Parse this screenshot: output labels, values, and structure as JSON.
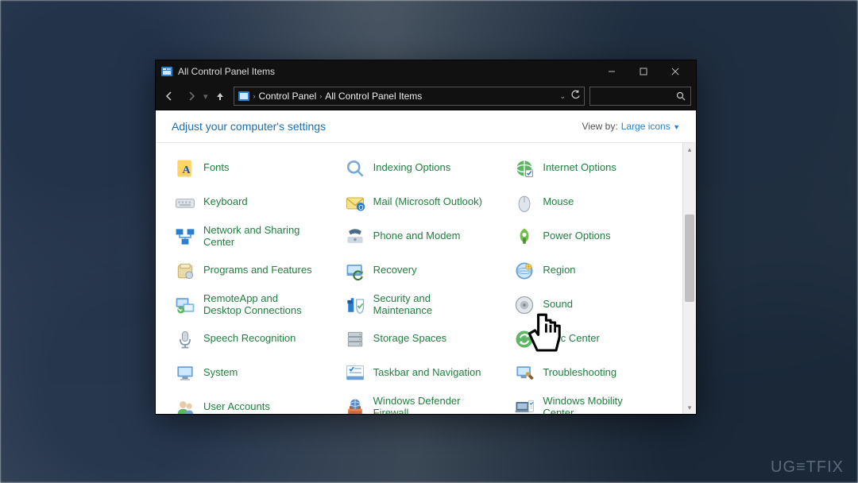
{
  "window_title": "All Control Panel Items",
  "breadcrumb": [
    "Control Panel",
    "All Control Panel Items"
  ],
  "subheader": {
    "title": "Adjust your computer's settings",
    "view_by_label": "View by:",
    "view_by_value": "Large icons"
  },
  "items": [
    {
      "label": "Fonts",
      "icon": "fonts-icon"
    },
    {
      "label": "Indexing Options",
      "icon": "indexing-icon"
    },
    {
      "label": "Internet Options",
      "icon": "internet-options-icon"
    },
    {
      "label": "Keyboard",
      "icon": "keyboard-icon"
    },
    {
      "label": "Mail (Microsoft Outlook)",
      "icon": "mail-icon"
    },
    {
      "label": "Mouse",
      "icon": "mouse-icon"
    },
    {
      "label": "Network and Sharing Center",
      "icon": "network-icon"
    },
    {
      "label": "Phone and Modem",
      "icon": "phone-modem-icon"
    },
    {
      "label": "Power Options",
      "icon": "power-icon"
    },
    {
      "label": "Programs and Features",
      "icon": "programs-icon"
    },
    {
      "label": "Recovery",
      "icon": "recovery-icon"
    },
    {
      "label": "Region",
      "icon": "region-icon"
    },
    {
      "label": "RemoteApp and Desktop Connections",
      "icon": "remoteapp-icon"
    },
    {
      "label": "Security and Maintenance",
      "icon": "security-icon"
    },
    {
      "label": "Sound",
      "icon": "sound-icon"
    },
    {
      "label": "Speech Recognition",
      "icon": "speech-icon"
    },
    {
      "label": "Storage Spaces",
      "icon": "storage-icon"
    },
    {
      "label": "Sync Center",
      "icon": "sync-icon"
    },
    {
      "label": "System",
      "icon": "system-icon"
    },
    {
      "label": "Taskbar and Navigation",
      "icon": "taskbar-icon"
    },
    {
      "label": "Troubleshooting",
      "icon": "troubleshoot-icon"
    },
    {
      "label": "User Accounts",
      "icon": "user-accounts-icon"
    },
    {
      "label": "Windows Defender Firewall",
      "icon": "defender-icon"
    },
    {
      "label": "Windows Mobility Center",
      "icon": "mobility-icon"
    }
  ],
  "watermark": "UG≡TFIX"
}
